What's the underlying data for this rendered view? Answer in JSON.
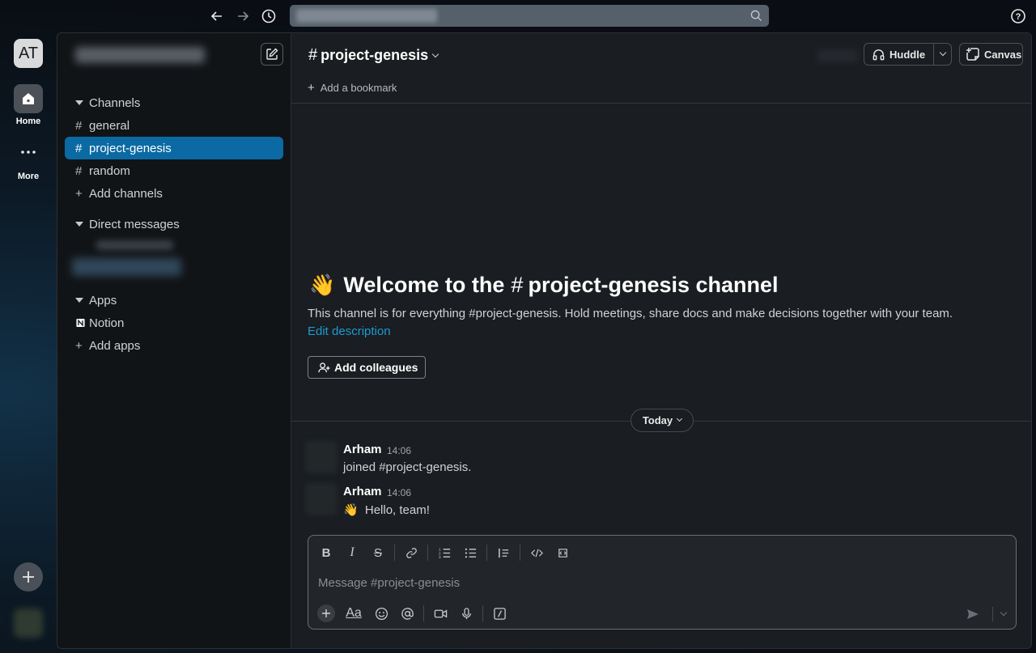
{
  "topbar": {
    "back_icon": "arrow-left-icon",
    "forward_icon": "arrow-right-icon",
    "history_icon": "clock-icon",
    "search_icon": "search-icon",
    "help_icon": "help-circle-icon"
  },
  "rail": {
    "workspace_initials": "AT",
    "home_label": "Home",
    "more_label": "More"
  },
  "sidebar": {
    "channels_header": "Channels",
    "channels": [
      {
        "name": "general",
        "active": false
      },
      {
        "name": "project-genesis",
        "active": true
      },
      {
        "name": "random",
        "active": false
      }
    ],
    "add_channels": "Add channels",
    "dm_header": "Direct messages",
    "apps_header": "Apps",
    "apps": [
      {
        "name": "Notion"
      }
    ],
    "add_apps": "Add apps"
  },
  "header": {
    "channel_name": "project-genesis",
    "huddle_label": "Huddle",
    "canvas_label": "Canvas",
    "bookmark_label": "Add a bookmark"
  },
  "welcome": {
    "emoji": "👋",
    "title_prefix": "Welcome to the",
    "title_channel": "project-genesis channel",
    "description": "This channel is for everything #project-genesis. Hold meetings, share docs and make decisions together with your team.",
    "edit_link": "Edit description",
    "add_colleagues": "Add colleagues"
  },
  "timeline": {
    "day_label": "Today",
    "messages": [
      {
        "author": "Arham",
        "time": "14:06",
        "emoji": "",
        "text": "joined #project-genesis."
      },
      {
        "author": "Arham",
        "time": "14:06",
        "emoji": "👋",
        "text": "Hello, team!"
      }
    ]
  },
  "composer": {
    "placeholder": "Message #project-genesis",
    "format_aa": "Aa"
  },
  "colors": {
    "active_channel": "#0b6aa3",
    "link": "#1d9bd1",
    "main_bg": "#1a1d21",
    "sidebar_bg": "#111417"
  }
}
